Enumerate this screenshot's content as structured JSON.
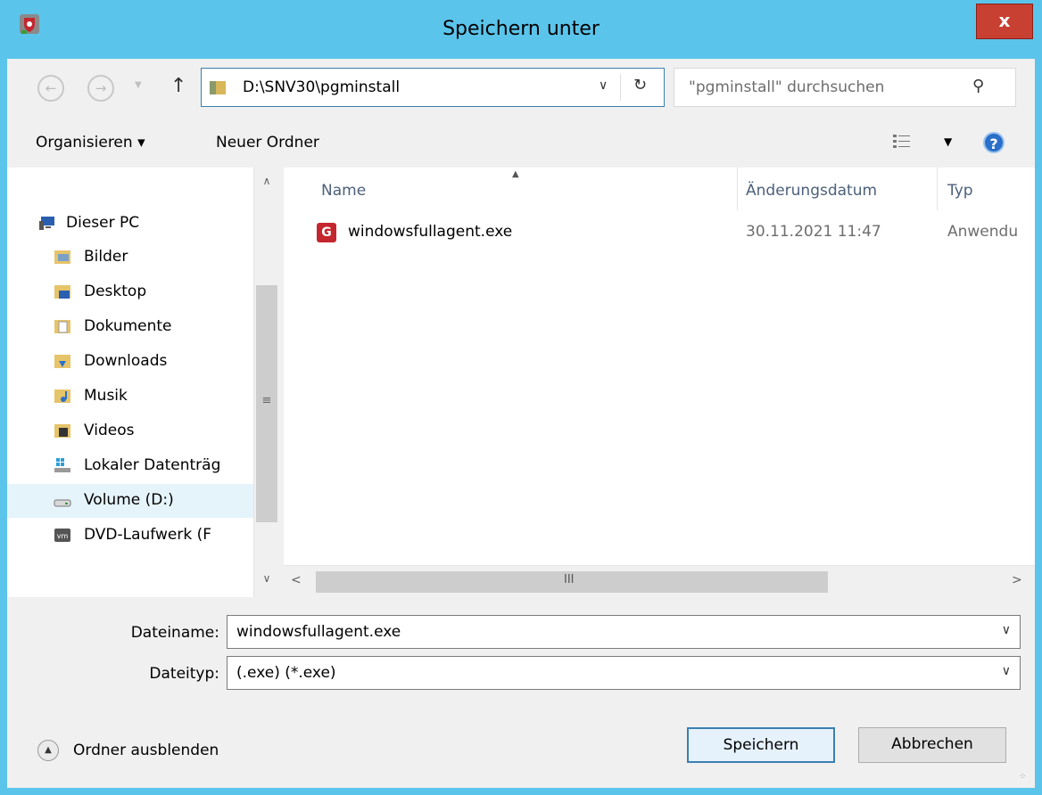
{
  "window": {
    "title": "Speichern unter",
    "close_label": "x"
  },
  "address": {
    "path": "D:\\SNV30\\pgminstall"
  },
  "search": {
    "placeholder": "\"pgminstall\" durchsuchen"
  },
  "toolbar": {
    "organize_label": "Organisieren ▾",
    "new_folder_label": "Neuer Ordner"
  },
  "sidebar": {
    "items": [
      {
        "label": "Dieser PC",
        "icon": "computer-icon"
      },
      {
        "label": "Bilder",
        "icon": "pictures-folder-icon"
      },
      {
        "label": "Desktop",
        "icon": "desktop-folder-icon"
      },
      {
        "label": "Dokumente",
        "icon": "documents-folder-icon"
      },
      {
        "label": "Downloads",
        "icon": "downloads-folder-icon"
      },
      {
        "label": "Musik",
        "icon": "music-folder-icon"
      },
      {
        "label": "Videos",
        "icon": "videos-folder-icon"
      },
      {
        "label": "Lokaler Datenträg",
        "icon": "local-drive-icon"
      },
      {
        "label": "Volume (D:)",
        "icon": "drive-icon"
      },
      {
        "label": "DVD-Laufwerk (F",
        "icon": "dvd-drive-icon"
      }
    ]
  },
  "file_list": {
    "columns": [
      "Name",
      "Änderungsdatum",
      "Typ"
    ],
    "rows": [
      {
        "name": "windowsfullagent.exe",
        "date": "30.11.2021 11:47",
        "type": "Anwendu"
      }
    ]
  },
  "form": {
    "filename_label": "Dateiname:",
    "filename_value": "windowsfullagent.exe",
    "filetype_label": "Dateityp:",
    "filetype_value": "(.exe) (*.exe)"
  },
  "footer": {
    "hide_folders_label": "Ordner ausblenden",
    "save_label": "Speichern",
    "cancel_label": "Abbrechen"
  },
  "colors": {
    "titlebar": "#5bc4ea",
    "close": "#c74032",
    "app_red": "#c4262e"
  }
}
